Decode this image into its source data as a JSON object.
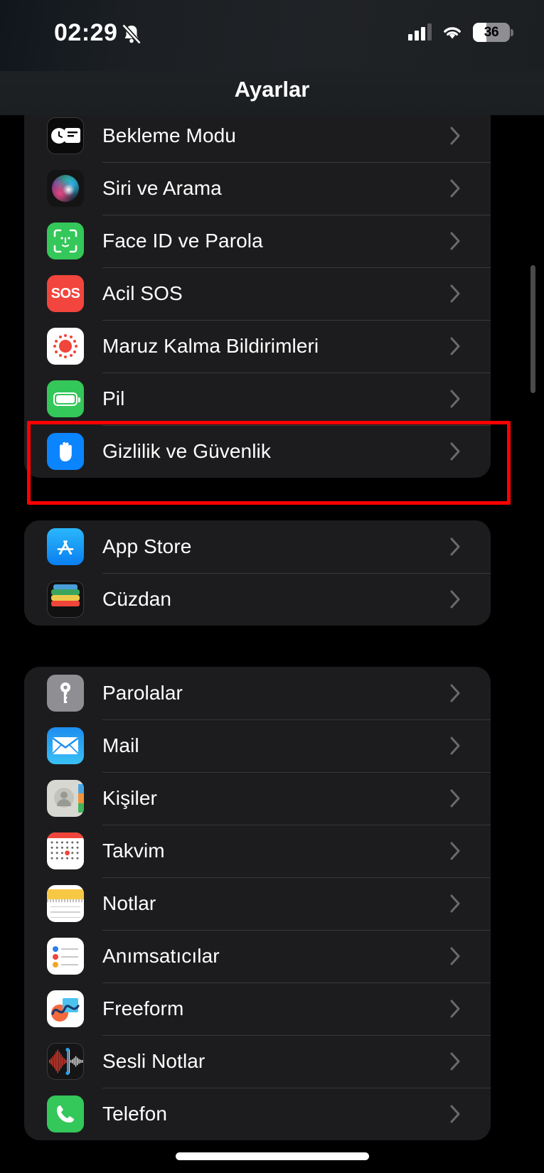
{
  "status_bar": {
    "time": "02:29",
    "bell_icon": "bell-slash-icon",
    "cellular_icon": "cellular-signal-icon",
    "wifi_icon": "wifi-icon",
    "battery_percent": "36",
    "battery_level": 36
  },
  "nav": {
    "title": "Ayarlar"
  },
  "groups": [
    {
      "id": "system-group",
      "rows": [
        {
          "label": "Bekleme Modu",
          "icon": "standby-icon",
          "highlighted": false
        },
        {
          "label": "Siri ve Arama",
          "icon": "siri-icon",
          "highlighted": false
        },
        {
          "label": "Face ID ve Parola",
          "icon": "face-id-icon",
          "highlighted": false
        },
        {
          "label": "Acil SOS",
          "icon": "emergency-sos-icon",
          "highlighted": false
        },
        {
          "label": "Maruz Kalma Bildirimleri",
          "icon": "exposure-notifications-icon",
          "highlighted": false
        },
        {
          "label": "Pil",
          "icon": "battery-icon",
          "highlighted": false
        },
        {
          "label": "Gizlilik ve Güvenlik",
          "icon": "privacy-hand-icon",
          "highlighted": true
        }
      ]
    },
    {
      "id": "store-group",
      "rows": [
        {
          "label": "App Store",
          "icon": "app-store-icon",
          "highlighted": false
        },
        {
          "label": "Cüzdan",
          "icon": "wallet-icon",
          "highlighted": false
        }
      ]
    },
    {
      "id": "apps-group",
      "rows": [
        {
          "label": "Parolalar",
          "icon": "passwords-key-icon",
          "highlighted": false
        },
        {
          "label": "Mail",
          "icon": "mail-icon",
          "highlighted": false
        },
        {
          "label": "Kişiler",
          "icon": "contacts-icon",
          "highlighted": false
        },
        {
          "label": "Takvim",
          "icon": "calendar-icon",
          "highlighted": false
        },
        {
          "label": "Notlar",
          "icon": "notes-icon",
          "highlighted": false
        },
        {
          "label": "Anımsatıcılar",
          "icon": "reminders-icon",
          "highlighted": false
        },
        {
          "label": "Freeform",
          "icon": "freeform-icon",
          "highlighted": false
        },
        {
          "label": "Sesli Notlar",
          "icon": "voice-memos-icon",
          "highlighted": false
        },
        {
          "label": "Telefon",
          "icon": "phone-icon",
          "highlighted": false
        }
      ]
    }
  ],
  "sos_label": "SOS",
  "chevron_icon": "chevron-right-icon",
  "colors": {
    "page_background": "#000000",
    "card_background": "#1c1c1e",
    "separator": "#38383a",
    "label_text": "#ffffff",
    "chevron": "#6a6a6e",
    "highlight_border": "#ff0000",
    "scrollbar": "#4a4a4c"
  }
}
